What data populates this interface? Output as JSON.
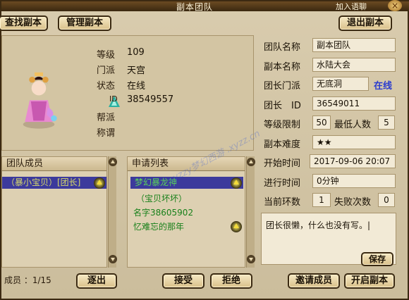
{
  "window": {
    "title": "副本团队",
    "title_right": "加入语聊",
    "close_glyph": "×"
  },
  "toolbar": {
    "find_dungeon": "查找副本",
    "manage_dungeon": "管理副本",
    "leave_dungeon": "退出副本"
  },
  "player": {
    "level_label": "等级",
    "level_value": "109",
    "sect_label": "门派",
    "sect_value": "天宫",
    "status_label": "状态",
    "status_value": "在线",
    "id_label": "ID",
    "id_value": "38549557",
    "guild_label": "帮派",
    "title_label": "称谓"
  },
  "team_info": {
    "team_name_label": "团队名称",
    "team_name_value": "副本团队",
    "dungeon_name_label": "副本名称",
    "dungeon_name_value": "水陆大会",
    "leader_sect_label": "团长门派",
    "leader_sect_value": "无底洞",
    "leader_status": "在线",
    "leader_id_label": "团长　ID",
    "leader_id_value": "36549011",
    "level_limit_label": "等级限制",
    "level_limit_value": "50",
    "min_people_label": "最低人数",
    "min_people_value": "5",
    "difficulty_label": "副本难度",
    "difficulty_value": "★★",
    "start_time_label": "开始时间",
    "start_time_value": "2017-09-06 20:07",
    "elapsed_label": "进行时间",
    "elapsed_value": "0分钟",
    "round_label": "当前环数",
    "round_value": "1",
    "fail_label": "失败次数",
    "fail_value": "0",
    "notice": "团长很懒，什么也没有写。|",
    "save": "保存"
  },
  "members": {
    "header": "团队成员",
    "selected_row": "（暴小宝贝）[团长]",
    "count_label": "成员 ：1/15",
    "kick": "逐出"
  },
  "applications": {
    "header": "申请列表",
    "selected_row": "梦幻暴龙神",
    "rows": [
      "（宝贝坏坏）",
      "名字38605902",
      "忆难忘的那年"
    ],
    "accept": "接受",
    "reject": "拒绝"
  },
  "actions": {
    "invite": "邀请成员",
    "open_dungeon": "开启副本"
  },
  "watermark": "xyzzy梦幻西游 .xyzz.cn",
  "colors": {
    "accent_blue": "#2a3ccf",
    "green_text": "#18801a",
    "selected_row_bg": "#3c3a9c"
  }
}
